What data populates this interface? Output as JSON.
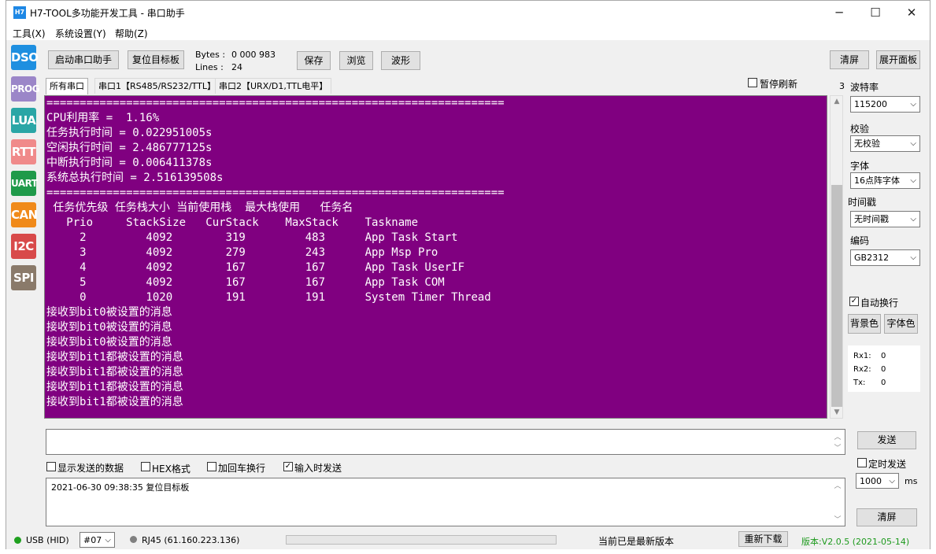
{
  "window": {
    "icon_text": "H7",
    "title": "H7-TOOL多功能开发工具 - 串口助手",
    "controls": {
      "minimize": "─",
      "maximize": "☐",
      "close": "✕"
    }
  },
  "menu": [
    "工具(X)",
    "系统设置(Y)",
    "帮助(Z)"
  ],
  "tools": [
    {
      "label": "DSO",
      "color": "#1e8fe0"
    },
    {
      "label": "PROG",
      "color": "#9b86c8"
    },
    {
      "label": "LUA",
      "color": "#2aa6a6"
    },
    {
      "label": "RTT",
      "color": "#f08a8a"
    },
    {
      "label": "UART",
      "color": "#1f9a4a"
    },
    {
      "label": "CAN",
      "color": "#f08a1a"
    },
    {
      "label": "I2C",
      "color": "#d84a4a"
    },
    {
      "label": "SPI",
      "color": "#8a7a6a"
    }
  ],
  "toolbar": {
    "start_label": "启动串口助手",
    "reset_label": "复位目标板",
    "bytes_label": "Bytes :",
    "bytes_value": "0 000 983",
    "lines_label": "Lines :",
    "lines_value": "24",
    "save_label": "保存",
    "browse_label": "浏览",
    "wave_label": "波形",
    "clear_label": "清屏",
    "expand_label": "展开面板"
  },
  "tabs": [
    "所有串口",
    "串口1【RS485/RS232/TTL】",
    "串口2【URX/D1,TTL电平】"
  ],
  "pause_refresh_label": "暂停刷新",
  "panel_number": "3",
  "terminal": {
    "lines": [
      "=====================================================================",
      "CPU利用率 =  1.16%",
      "任务执行时间 = 0.022951005s",
      "空闲执行时间 = 2.486777125s",
      "中断执行时间 = 0.006411378s",
      "系统总执行时间 = 2.516139508s",
      "=====================================================================",
      " 任务优先级 任务栈大小 当前使用栈  最大栈使用   任务名",
      "   Prio     StackSize   CurStack    MaxStack    Taskname",
      "     2         4092        319         483      App Task Start",
      "     3         4092        279         243      App Msp Pro",
      "     4         4092        167         167      App Task UserIF",
      "     5         4092        167         167      App Task COM",
      "     0         1020        191         191      System Timer Thread",
      "接收到bit0被设置的消息",
      "接收到bit0被设置的消息",
      "接收到bit0被设置的消息",
      "接收到bit1都被设置的消息",
      "接收到bit1都被设置的消息",
      "接收到bit1都被设置的消息",
      "接收到bit1都被设置的消息"
    ]
  },
  "settings": {
    "baud_label": "波特率",
    "baud_value": "115200",
    "parity_label": "校验",
    "parity_value": "无校验",
    "font_label": "字体",
    "font_value": "16点阵字体",
    "timestamp_label": "时间戳",
    "timestamp_value": "无时间戳",
    "encoding_label": "编码",
    "encoding_value": "GB2312",
    "autowrap_label": "自动换行",
    "autowrap_checked": true,
    "bgcolor_label": "背景色",
    "fontcolor_label": "字体色"
  },
  "stats": {
    "rx1_label": "Rx1:",
    "rx1_value": "0",
    "rx2_label": "Rx2:",
    "rx2_value": "0",
    "tx_label": "Tx:",
    "tx_value": "0"
  },
  "send": {
    "input_value": "",
    "send_label": "发送",
    "timed_send_label": "定时发送",
    "interval_value": "1000",
    "interval_unit": "ms",
    "clear_label": "清屏",
    "show_sent_label": "显示发送的数据",
    "hex_label": "HEX格式",
    "crlf_label": "加回车换行",
    "send_on_input_label": "输入时发送",
    "send_on_input_checked": true
  },
  "log": {
    "text": "2021-06-30 09:38:35 复位目标板"
  },
  "status": {
    "usb_label": "USB (HID)",
    "usb_color": "#1fa01f",
    "device_value": "#07",
    "rj45_label": "RJ45 (61.160.223.136)",
    "rj45_color": "#808080",
    "update_status": "当前已是最新版本",
    "redownload_label": "重新下载",
    "version": "版本:V2.0.5 (2021-05-14)",
    "version_color": "#1e9a1e"
  }
}
